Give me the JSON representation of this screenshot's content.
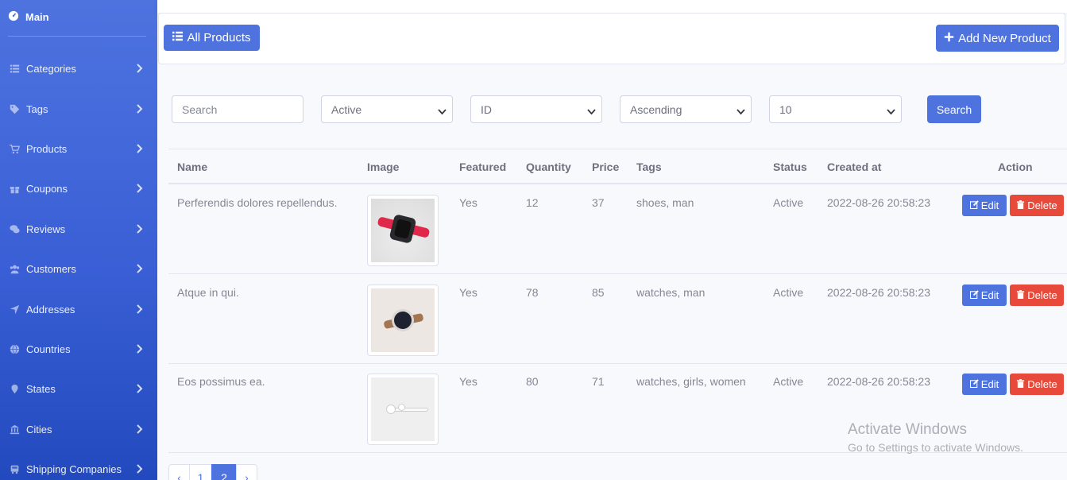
{
  "sidebar": {
    "brand": "Main",
    "items": [
      {
        "label": "Categories",
        "icon": "list-icon"
      },
      {
        "label": "Tags",
        "icon": "tag-icon"
      },
      {
        "label": "Products",
        "icon": "cart-icon"
      },
      {
        "label": "Coupons",
        "icon": "gift-icon"
      },
      {
        "label": "Reviews",
        "icon": "comments-icon"
      },
      {
        "label": "Customers",
        "icon": "users-icon"
      },
      {
        "label": "Addresses",
        "icon": "location-arrow-icon"
      },
      {
        "label": "Countries",
        "icon": "globe-icon"
      },
      {
        "label": "States",
        "icon": "map-marker-icon"
      },
      {
        "label": "Cities",
        "icon": "university-icon"
      },
      {
        "label": "Shipping Companies",
        "icon": "truck-icon"
      }
    ]
  },
  "header": {
    "all_products_label": "All Products",
    "add_new_label": "Add New Product"
  },
  "filters": {
    "search_placeholder": "Search",
    "status_selected": "Active",
    "sort_by_selected": "ID",
    "order_selected": "Ascending",
    "limit_selected": "10",
    "search_button": "Search"
  },
  "table": {
    "columns": [
      "Name",
      "Image",
      "Featured",
      "Quantity",
      "Price",
      "Tags",
      "Status",
      "Created at",
      "Action"
    ],
    "rows": [
      {
        "name": "Perferendis dolores repellendus.",
        "image": "red-smartwatch",
        "featured": "Yes",
        "quantity": "12",
        "price": "37",
        "tags": "shoes, man",
        "status": "Active",
        "created_at": "2022-08-26 20:58:23"
      },
      {
        "name": "Atque in qui.",
        "image": "leather-strap-watch",
        "featured": "Yes",
        "quantity": "78",
        "price": "85",
        "tags": "watches, man",
        "status": "Active",
        "created_at": "2022-08-26 20:58:23"
      },
      {
        "name": "Eos possimus ea.",
        "image": "white-earbuds",
        "featured": "Yes",
        "quantity": "80",
        "price": "71",
        "tags": "watches, girls, women",
        "status": "Active",
        "created_at": "2022-08-26 20:58:23"
      }
    ],
    "edit_label": "Edit",
    "delete_label": "Delete"
  },
  "pagination": {
    "prev": "‹",
    "pages": [
      "1",
      "2"
    ],
    "current": "2",
    "next": "›"
  },
  "watermark": {
    "title": "Activate Windows",
    "subtitle": "Go to Settings to activate Windows."
  },
  "colors": {
    "primary": "#4e73df",
    "danger": "#e74a3b",
    "sidebar_start": "#4e73df",
    "sidebar_end": "#224abe",
    "background": "#f8f9fc"
  }
}
